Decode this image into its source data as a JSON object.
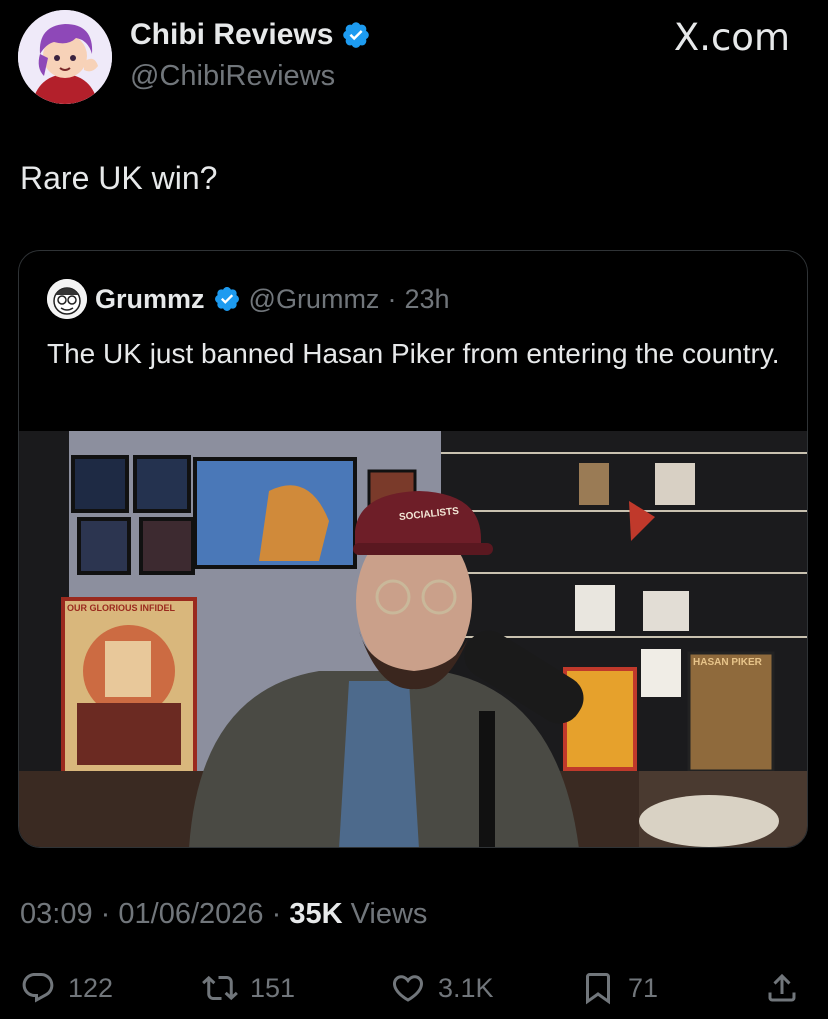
{
  "author": {
    "name": "Chibi Reviews",
    "handle": "@ChibiReviews",
    "verified": true
  },
  "site_label": "X.com",
  "tweet_text": "Rare UK win?",
  "quote": {
    "name": "Grummz",
    "handle": "@Grummz",
    "separator": "·",
    "time": "23h",
    "text": "The UK just banned Hasan Piker from entering the country.",
    "media": {
      "cap_text": "SOCIALISTS",
      "poster_left": "OUR GLORIOUS INFIDEL",
      "poster_right": "HASAN PIKER"
    }
  },
  "meta": {
    "time": "03:09",
    "sep1": "·",
    "date": "01/06/2026",
    "sep2": "·",
    "views_count": "35K",
    "views_label": "Views"
  },
  "actions": {
    "replies": "122",
    "reposts": "151",
    "likes": "3.1K",
    "bookmarks": "71"
  },
  "colors": {
    "background": "#000000",
    "text_primary": "#e7e9ea",
    "text_secondary": "#71767b",
    "verified": "#1d9bf0",
    "border": "#2f3336"
  }
}
